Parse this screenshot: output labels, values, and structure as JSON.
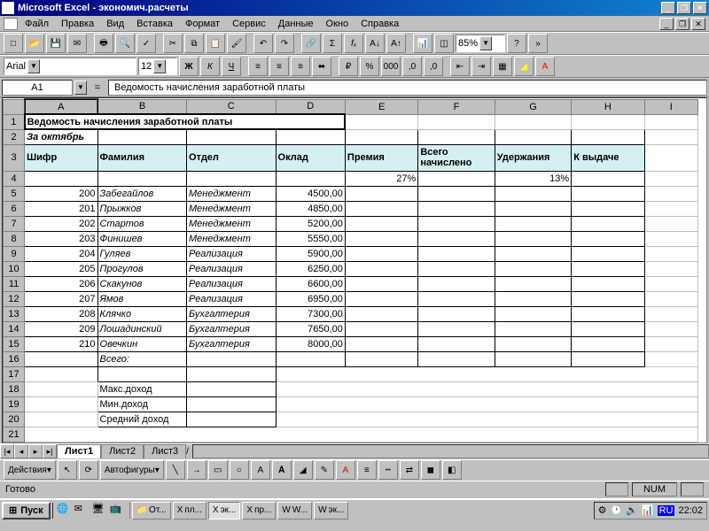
{
  "title": "Microsoft Excel - экономич.расчеты",
  "menu": [
    "Файл",
    "Правка",
    "Вид",
    "Вставка",
    "Формат",
    "Сервис",
    "Данные",
    "Окно",
    "Справка"
  ],
  "font": {
    "name": "Arial",
    "size": "12"
  },
  "zoom": "85%",
  "namebox": "A1",
  "formula": "Ведомость начисления заработной платы",
  "cols": [
    "A",
    "B",
    "C",
    "D",
    "E",
    "F",
    "G",
    "H",
    "I"
  ],
  "row1": "Ведомость начисления заработной платы",
  "row2": "За октябрь",
  "headers": [
    "Шифр",
    "Фамилия",
    "Отдел",
    "Оклад",
    "Премия",
    "Всего начислено",
    "Удержания",
    "К выдаче"
  ],
  "row4": {
    "premia": "27%",
    "uderzh": "13%"
  },
  "rows": [
    {
      "n": "5",
      "code": "200",
      "fam": "Забегайлов",
      "dept": "Менеджмент",
      "oklad": "4500,00"
    },
    {
      "n": "6",
      "code": "201",
      "fam": "Прыжков",
      "dept": "Менеджмент",
      "oklad": "4850,00"
    },
    {
      "n": "7",
      "code": "202",
      "fam": "Стартов",
      "dept": "Менеджмент",
      "oklad": "5200,00"
    },
    {
      "n": "8",
      "code": "203",
      "fam": "Финишев",
      "dept": "Менеджмент",
      "oklad": "5550,00"
    },
    {
      "n": "9",
      "code": "204",
      "fam": "Гуляев",
      "dept": "Реализация",
      "oklad": "5900,00"
    },
    {
      "n": "10",
      "code": "205",
      "fam": "Прогулов",
      "dept": "Реализация",
      "oklad": "6250,00"
    },
    {
      "n": "11",
      "code": "206",
      "fam": "Скакунов",
      "dept": "Реализация",
      "oklad": "6600,00"
    },
    {
      "n": "12",
      "code": "207",
      "fam": "Ямов",
      "dept": "Реализация",
      "oklad": "6950,00"
    },
    {
      "n": "13",
      "code": "208",
      "fam": "Клячко",
      "dept": "Бухгалтерия",
      "oklad": "7300,00"
    },
    {
      "n": "14",
      "code": "209",
      "fam": "Лошадинский",
      "dept": "Бухгалтерия",
      "oklad": "7650,00"
    },
    {
      "n": "15",
      "code": "210",
      "fam": "Овечкин",
      "dept": "Бухгалтерия",
      "oklad": "8000,00"
    }
  ],
  "totals": {
    "vsego": "Всего:",
    "max": "Макс.доход",
    "min": "Мин.доход",
    "avg": "Средний доход"
  },
  "sheets": [
    "Лист1",
    "Лист2",
    "Лист3"
  ],
  "drawbar": {
    "actions": "Действия",
    "autoshapes": "Автофигуры"
  },
  "status": {
    "ready": "Готово",
    "num": "NUM"
  },
  "taskbar": {
    "start": "Пуск",
    "items": [
      "От...",
      "пл...",
      "эк...",
      "пр...",
      "W...",
      "эк..."
    ],
    "lang": "RU",
    "time": "22:02"
  }
}
